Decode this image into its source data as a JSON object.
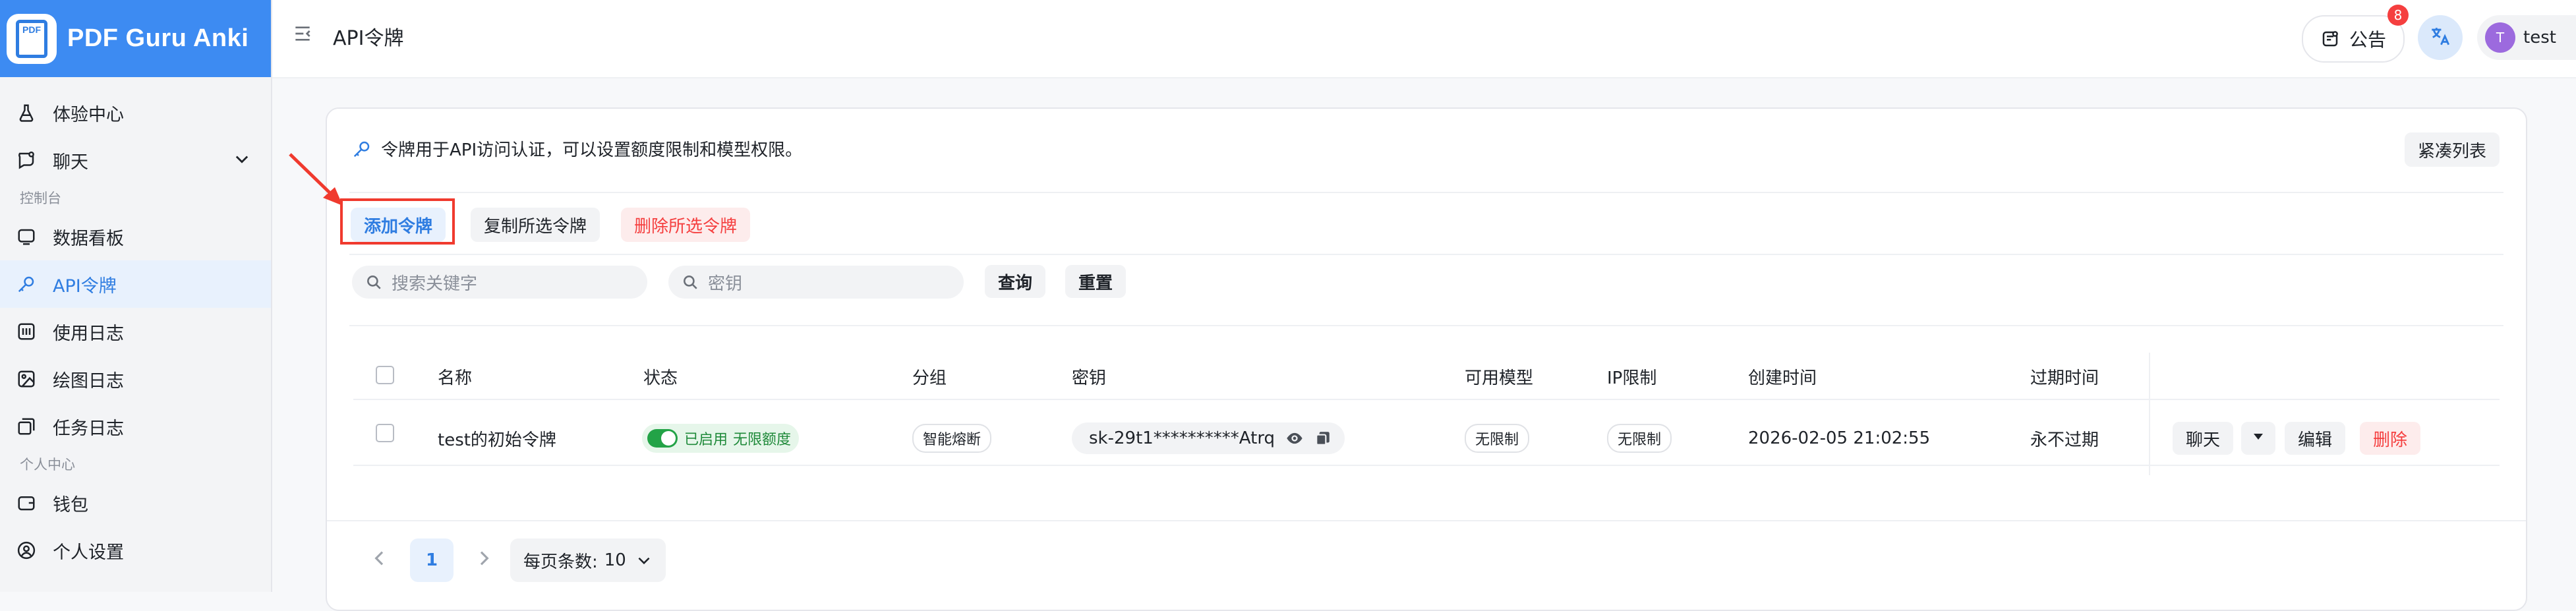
{
  "brand": {
    "logo_text": "PDF",
    "name": "PDF Guru Anki"
  },
  "sidebar": {
    "items": [
      {
        "label": "体验中心",
        "icon": "flask-icon"
      },
      {
        "label": "聊天",
        "icon": "chat-bubble-icon"
      },
      {
        "label": "数据看板",
        "icon": "dashboard-icon"
      },
      {
        "label": "API令牌",
        "icon": "key-icon",
        "active": true
      },
      {
        "label": "使用日志",
        "icon": "log-icon"
      },
      {
        "label": "绘图日志",
        "icon": "image-icon"
      },
      {
        "label": "任务日志",
        "icon": "task-icon"
      },
      {
        "label": "钱包",
        "icon": "wallet-icon"
      },
      {
        "label": "个人设置",
        "icon": "user-circle-icon"
      }
    ],
    "sections": {
      "console": "控制台",
      "personal": "个人中心"
    }
  },
  "header": {
    "title": "API令牌",
    "notice_label": "公告",
    "notice_count": "8",
    "user_initial": "T",
    "user_name": "test"
  },
  "card": {
    "info_text": "令牌用于API访问认证，可以设置额度限制和模型权限。",
    "compact_label": "紧凑列表",
    "add_label": "添加令牌",
    "copy_label": "复制所选令牌",
    "delete_selected_label": "删除所选令牌",
    "search_keyword_placeholder": "搜索关键字",
    "search_key_placeholder": "密钥",
    "query_label": "查询",
    "reset_label": "重置"
  },
  "table": {
    "columns": [
      "名称",
      "状态",
      "分组",
      "密钥",
      "可用模型",
      "IP限制",
      "创建时间",
      "过期时间"
    ],
    "rows": [
      {
        "name": "test的初始令牌",
        "status_enabled": "已启用",
        "status_quota": "无限额度",
        "group": "智能熔断",
        "key": "sk-29t1**********Atrq",
        "models": "无限制",
        "ip": "无限制",
        "created": "2026-02-05 21:02:55",
        "expires": "永不过期",
        "actions": {
          "chat": "聊天",
          "edit": "编辑",
          "delete": "删除"
        }
      }
    ]
  },
  "pagination": {
    "current_page": "1",
    "page_size_label": "每页条数:",
    "page_size": "10"
  },
  "colors": {
    "accent": "#2f7de1",
    "brand": "#3d8bf2",
    "danger": "#f53f3f",
    "success": "#23a347",
    "annotation": "#f03a2e"
  }
}
